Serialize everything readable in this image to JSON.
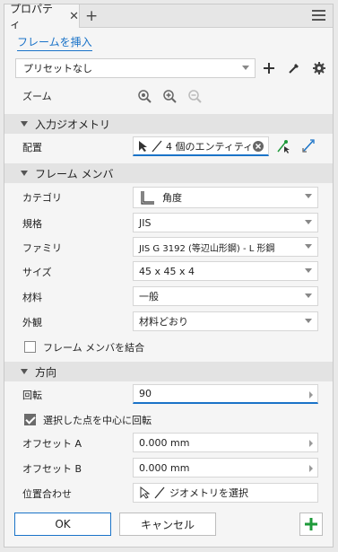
{
  "tab": {
    "title": "プロパティ",
    "close": "✕",
    "add": "+"
  },
  "insert_frame_link": "フレームを挿入",
  "preset": {
    "value": "プリセットなし"
  },
  "zoom": {
    "label": "ズーム"
  },
  "input_geometry": {
    "header": "入力ジオメトリ",
    "placement_label": "配置",
    "placement_value": "4 個のエンティティ"
  },
  "frame_member": {
    "header": "フレーム メンバ",
    "category_label": "カテゴリ",
    "category_value": "角度",
    "standard_label": "規格",
    "standard_value": "JIS",
    "family_label": "ファミリ",
    "family_value": "JIS G 3192 (等辺山形鋼) - L 形鋼",
    "size_label": "サイズ",
    "size_value": "45 x 45 x 4",
    "material_label": "材料",
    "material_value": "一般",
    "appearance_label": "外観",
    "appearance_value": "材料どおり",
    "merge_label": "フレーム メンバを結合"
  },
  "orientation": {
    "header": "方向",
    "rotation_label": "回転",
    "rotation_value": "90",
    "center_check_label": "選択した点を中心に回転",
    "offset_a_label": "オフセット A",
    "offset_a_value": "0.000 mm",
    "offset_b_label": "オフセット B",
    "offset_b_value": "0.000 mm",
    "align_label": "位置合わせ",
    "align_value": "ジオメトリを選択"
  },
  "footer": {
    "ok": "OK",
    "cancel": "キャンセル"
  },
  "colors": {
    "accent": "#1a73c8",
    "green": "#1e9a3a"
  }
}
